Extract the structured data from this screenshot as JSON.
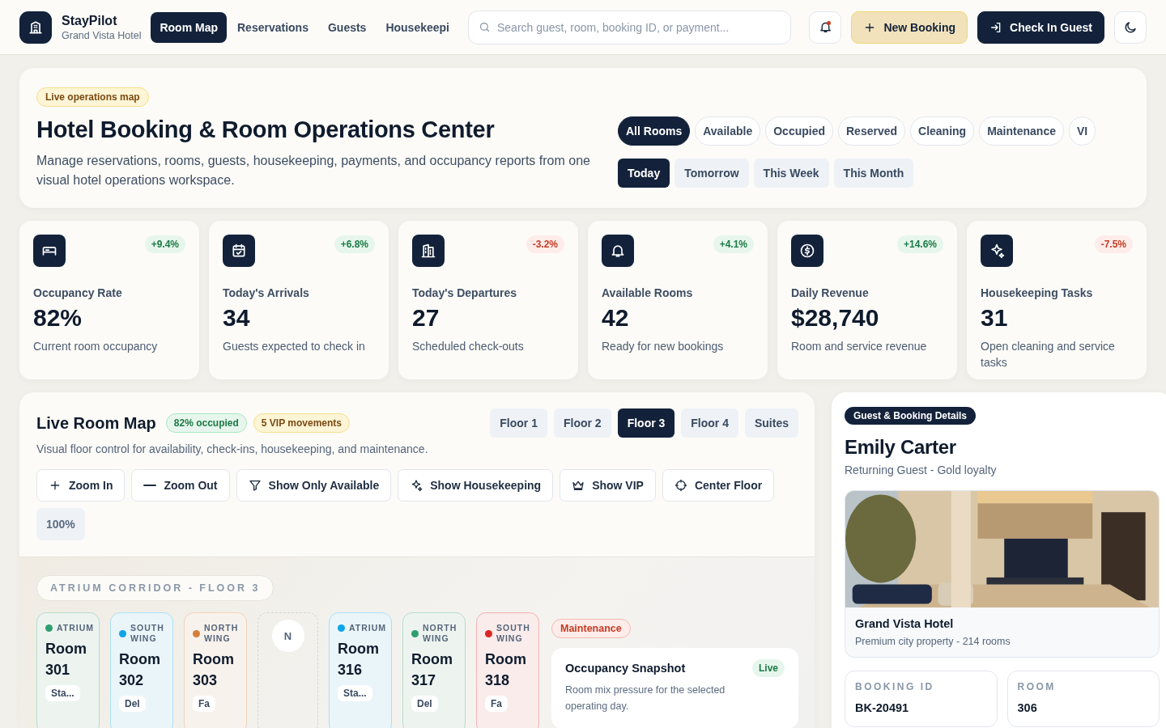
{
  "brand": {
    "name": "StayPilot",
    "subtitle": "Grand Vista Hotel"
  },
  "nav": [
    {
      "label": "Room Map",
      "selected": true
    },
    {
      "label": "Reservations",
      "selected": false
    },
    {
      "label": "Guests",
      "selected": false
    },
    {
      "label": "Housekeepi",
      "selected": false
    }
  ],
  "search": {
    "placeholder": "Search guest, room, booking ID, or payment..."
  },
  "notifications": {
    "unread": true
  },
  "actions": [
    {
      "label": "New Booking",
      "kind": "accent"
    },
    {
      "label": "Check In Guest",
      "kind": "primary"
    }
  ],
  "hero": {
    "badge": "Live operations map",
    "title": "Hotel Booking & Room Operations Center",
    "description": "Manage reservations, rooms, guests, housekeeping, payments, and occupancy reports from one visual hotel operations workspace.",
    "filters": [
      {
        "label": "All Rooms",
        "selected": true
      },
      {
        "label": "Available",
        "selected": false
      },
      {
        "label": "Occupied",
        "selected": false
      },
      {
        "label": "Reserved",
        "selected": false
      },
      {
        "label": "Cleaning",
        "selected": false
      },
      {
        "label": "Maintenance",
        "selected": false
      },
      {
        "label": "VI",
        "selected": false
      }
    ],
    "periods": [
      {
        "label": "Today",
        "selected": true
      },
      {
        "label": "Tomorrow",
        "selected": false
      },
      {
        "label": "This Week",
        "selected": false
      },
      {
        "label": "This Month",
        "selected": false
      }
    ]
  },
  "stats": [
    {
      "delta": "+9.4%",
      "positive": true,
      "label": "Occupancy Rate",
      "value": "82%",
      "caption": "Current room occupancy"
    },
    {
      "delta": "+6.8%",
      "positive": true,
      "label": "Today's Arrivals",
      "value": "34",
      "caption": "Guests expected to check in"
    },
    {
      "delta": "-3.2%",
      "positive": false,
      "label": "Today's Departures",
      "value": "27",
      "caption": "Scheduled check-outs"
    },
    {
      "delta": "+4.1%",
      "positive": true,
      "label": "Available Rooms",
      "value": "42",
      "caption": "Ready for new bookings"
    },
    {
      "delta": "+14.6%",
      "positive": true,
      "label": "Daily Revenue",
      "value": "$28,740",
      "caption": "Room and service revenue"
    },
    {
      "delta": "-7.5%",
      "positive": false,
      "label": "Housekeeping Tasks",
      "value": "31",
      "caption": "Open cleaning and service tasks"
    }
  ],
  "room_map": {
    "title": "Live Room Map",
    "badges": [
      {
        "label": "82% occupied",
        "kind": "success"
      },
      {
        "label": "5 VIP movements",
        "kind": "warning"
      }
    ],
    "description": "Visual floor control for availability, check-ins, housekeeping, and maintenance.",
    "floors": [
      {
        "label": "Floor 1",
        "selected": false
      },
      {
        "label": "Floor 2",
        "selected": false
      },
      {
        "label": "Floor 3",
        "selected": true
      },
      {
        "label": "Floor 4",
        "selected": false
      },
      {
        "label": "Suites",
        "selected": false
      }
    ],
    "tools": [
      {
        "label": "Zoom In"
      },
      {
        "label": "Zoom Out"
      },
      {
        "label": "Show Only Available"
      },
      {
        "label": "Show Housekeeping"
      },
      {
        "label": "Show VIP"
      },
      {
        "label": "Center Floor"
      }
    ],
    "zoom": "100%",
    "corridor": "ATRIUM CORRIDOR - FLOOR 3",
    "rooms": [
      {
        "kind": "room",
        "wing": "ATRIUM",
        "name": "Room 301",
        "note": "Sta...",
        "color": "#2f9e6e"
      },
      {
        "kind": "room",
        "wing": "SOUTH WING",
        "name": "Room 302",
        "note": "Del",
        "color": "#0ea5e9"
      },
      {
        "kind": "room",
        "wing": "NORTH WING",
        "name": "Room 303",
        "note": "Fa",
        "color": "#d4803a"
      },
      {
        "kind": "placeholder",
        "initial": "N"
      },
      {
        "kind": "room",
        "wing": "ATRIUM",
        "name": "Room 316",
        "note": "Sta...",
        "color": "#0ea5e9"
      },
      {
        "kind": "room",
        "wing": "NORTH WING",
        "name": "Room 317",
        "note": "Del",
        "color": "#2f9e6e"
      },
      {
        "kind": "room",
        "wing": "SOUTH WING",
        "name": "Room 318",
        "note": "Fa",
        "color": "#dc2626"
      }
    ],
    "status_tag": "Maintenance",
    "snapshot": {
      "title": "Occupancy Snapshot",
      "badge": "Live",
      "description": "Room mix pressure for the selected operating day."
    }
  },
  "guest": {
    "badge": "Guest & Booking Details",
    "name": "Emily Carter",
    "subtitle": "Returning Guest - Gold loyalty",
    "hotel": {
      "name": "Grand Vista Hotel",
      "description": "Premium city property - 214 rooms"
    },
    "fields": [
      {
        "label": "BOOKING ID",
        "value": "BK-20491"
      },
      {
        "label": "ROOM",
        "value": "306"
      }
    ]
  }
}
